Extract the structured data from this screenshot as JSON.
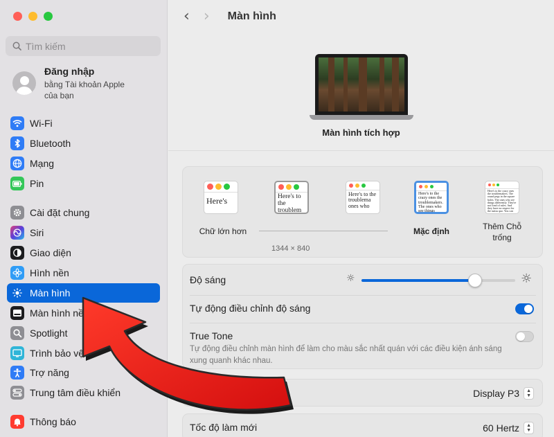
{
  "sidebar": {
    "search_placeholder": "Tìm kiếm",
    "account": {
      "name": "Đăng nhập",
      "subtitle": "bằng Tài khoản Apple của bạn"
    },
    "items": [
      {
        "label": "Wi-Fi",
        "icon": "wifi-icon",
        "color": "#2f7cf6"
      },
      {
        "label": "Bluetooth",
        "icon": "bluetooth-icon",
        "color": "#2f7cf6"
      },
      {
        "label": "Mạng",
        "icon": "globe-icon",
        "color": "#2f7cf6"
      },
      {
        "label": "Pin",
        "icon": "battery-icon",
        "color": "#34c759"
      },
      {
        "label": "Cài đặt chung",
        "icon": "gear-icon",
        "color": "#8e8e93"
      },
      {
        "label": "Siri",
        "icon": "siri-icon",
        "color": "#3a2f6b"
      },
      {
        "label": "Giao diện",
        "icon": "appearance-icon",
        "color": "#1c1c1e"
      },
      {
        "label": "Hình nền",
        "icon": "flower-icon",
        "color": "#2f9cf6"
      },
      {
        "label": "Màn hình",
        "icon": "sun-icon",
        "color": "#0a67d9"
      },
      {
        "label": "Màn hình nề",
        "icon": "screensaver-icon",
        "color": "#1c1c1e"
      },
      {
        "label": "Spotlight",
        "icon": "magnifier-icon",
        "color": "#8e8e93"
      },
      {
        "label": "Trình bảo vệ m",
        "icon": "screen-saver-icon",
        "color": "#2fb5d8"
      },
      {
        "label": "Trợ năng",
        "icon": "accessibility-icon",
        "color": "#2f7cf6"
      },
      {
        "label": "Trung tâm điều khiển",
        "icon": "control-center-icon",
        "color": "#8e8e93"
      },
      {
        "label": "Thông báo",
        "icon": "bell-icon",
        "color": "#ff3b30"
      }
    ]
  },
  "main": {
    "title": "Màn hình",
    "display_name": "Màn hình tích hợp",
    "resolution_options": [
      {
        "label": "Chữ lớn hơn",
        "sample": "Here's"
      },
      {
        "label": "",
        "sample": "Here's to the troublem"
      },
      {
        "label": "",
        "sample": "Here's to the troublema ones who"
      },
      {
        "label": "Mặc định",
        "sample": "Here's to the crazy ones the troublemakers. The ones who see things rules. And they"
      },
      {
        "label": "Thêm Chỗ trống",
        "sample": "Here's to the crazy ones the troublemakers. The round pegs in the square holes. The ones who see things differently. They're not fond of rules. And they have no respect for the status quo. You can quote them, disagree with them, glorify or vilify them."
      }
    ],
    "resolution_size": "1344 × 840",
    "brightness": {
      "label": "Độ sáng",
      "level": 0.74
    },
    "auto_brightness": {
      "label": "Tự động điều chỉnh độ sáng",
      "on": true
    },
    "true_tone": {
      "label": "True Tone",
      "on": false,
      "description": "Tự động điều chỉnh màn hình để làm cho màu sắc nhất quán với các điều kiện ánh sáng xung quanh khác nhau."
    },
    "color_profile": {
      "value": "Display P3"
    },
    "refresh_rate": {
      "label": "Tốc độ làm mới",
      "value": "60 Hertz"
    }
  }
}
